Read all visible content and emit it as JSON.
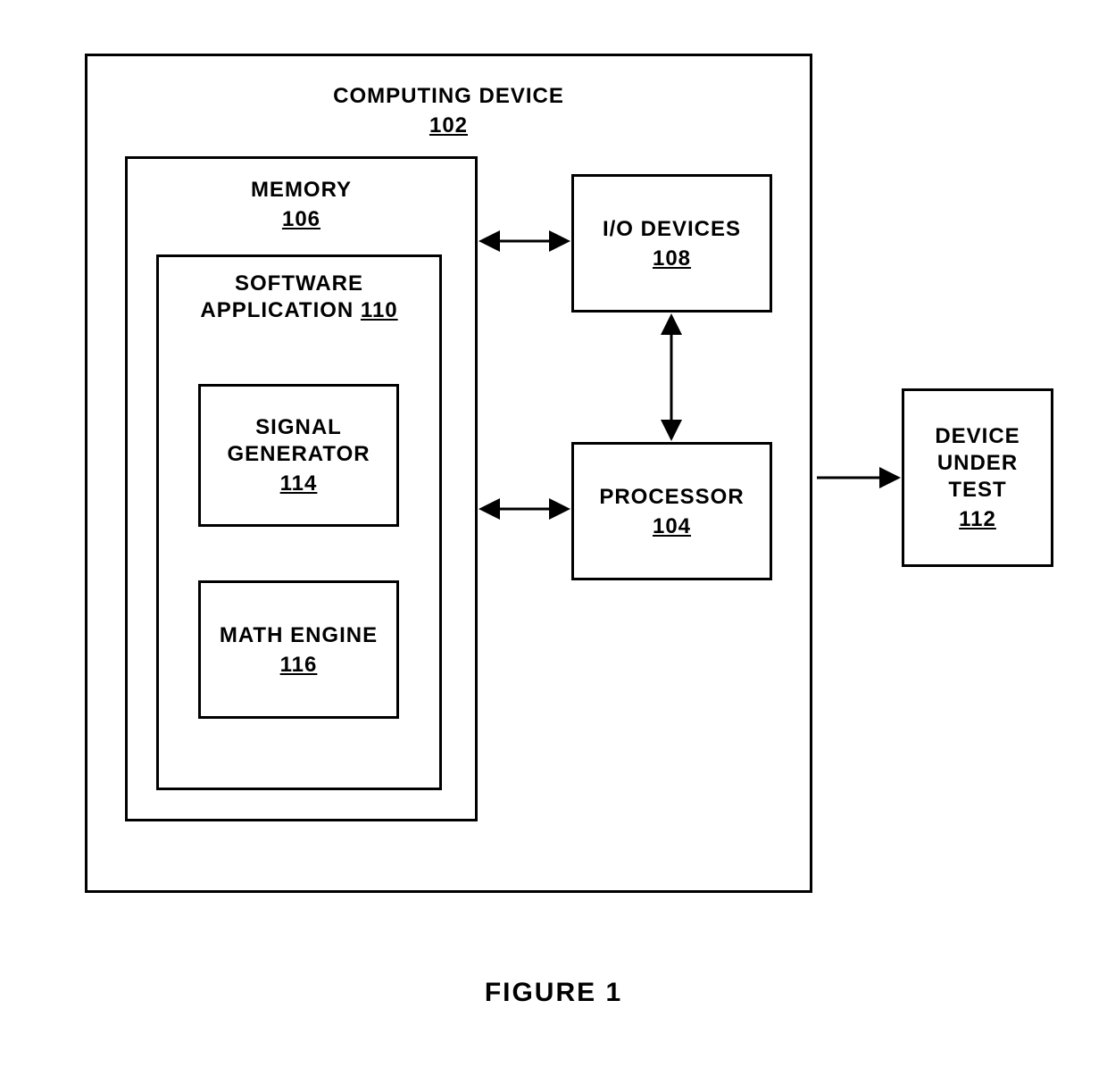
{
  "figure": {
    "caption": "FIGURE 1"
  },
  "computing_device": {
    "label": "COMPUTING DEVICE",
    "ref": "102"
  },
  "memory": {
    "label": "MEMORY",
    "ref": "106"
  },
  "software_application": {
    "label": "SOFTWARE\nAPPLICATION",
    "ref": "110"
  },
  "signal_generator": {
    "label": "SIGNAL\nGENERATOR",
    "ref": "114"
  },
  "math_engine": {
    "label": "MATH ENGINE",
    "ref": "116"
  },
  "io_devices": {
    "label": "I/O DEVICES",
    "ref": "108"
  },
  "processor": {
    "label": "PROCESSOR",
    "ref": "104"
  },
  "device_under_test": {
    "label": "DEVICE\nUNDER\nTEST",
    "ref": "112"
  }
}
